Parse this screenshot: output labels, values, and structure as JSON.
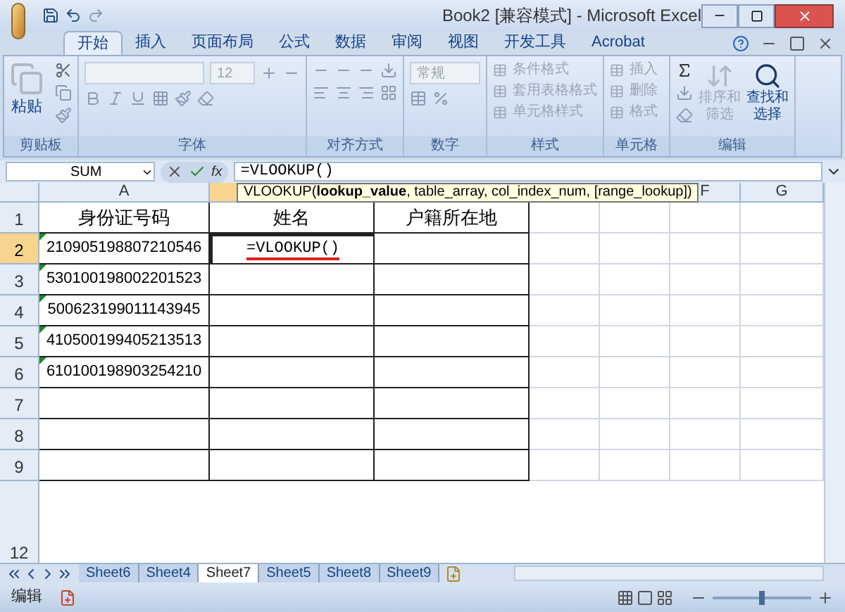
{
  "window": {
    "title": "Book2  [兼容模式] - Microsoft Excel"
  },
  "tabs": [
    {
      "label": "开始",
      "selected": true
    },
    {
      "label": "插入",
      "selected": false
    },
    {
      "label": "页面布局",
      "selected": false
    },
    {
      "label": "公式",
      "selected": false
    },
    {
      "label": "数据",
      "selected": false
    },
    {
      "label": "审阅",
      "selected": false
    },
    {
      "label": "视图",
      "selected": false
    },
    {
      "label": "开发工具",
      "selected": false
    },
    {
      "label": "Acrobat",
      "selected": false
    }
  ],
  "ribbon": [
    {
      "kind": "clipboard",
      "label": "剪贴板",
      "items": [
        {
          "label": "粘贴",
          "disabled": false
        }
      ]
    },
    {
      "kind": "font",
      "label": "字体",
      "items": [
        {
          "value": "12",
          "disabled": true
        }
      ]
    },
    {
      "kind": "align",
      "label": "对齐方式"
    },
    {
      "kind": "number",
      "label": "数字",
      "items": [
        {
          "value": "常规",
          "disabled": true
        }
      ]
    },
    {
      "kind": "styles",
      "label": "样式",
      "items": [
        {
          "label": "条件格式",
          "disabled": true
        },
        {
          "label": "套用表格格式",
          "disabled": true
        },
        {
          "label": "单元格样式",
          "disabled": true
        }
      ]
    },
    {
      "kind": "cells",
      "label": "单元格",
      "items": [
        {
          "label": "插入",
          "disabled": true
        },
        {
          "label": "删除",
          "disabled": true
        },
        {
          "label": "格式",
          "disabled": true
        }
      ]
    },
    {
      "kind": "editing",
      "label": "编辑",
      "items": [
        {
          "label": "排序和筛选",
          "disabled": true
        },
        {
          "label": "查找和选择",
          "disabled": false
        }
      ]
    }
  ],
  "formula_bar": {
    "name_box": "SUM",
    "fx": "fx",
    "formula": "=VLOOKUP()"
  },
  "tooltip": "VLOOKUP(**lookup_value**, table_array, col_index_num, [range_lookup])",
  "columns": [
    {
      "label": "A",
      "selected": false
    },
    {
      "selected": true
    },
    {
      "label": "F",
      "selected": false
    },
    {
      "label": "G",
      "selected": false
    }
  ],
  "rows": [
    {
      "label": "1",
      "selected": false,
      "cells": [
        {
          "text": "身份证号码"
        },
        {
          "text": "姓名"
        },
        {
          "text": "户籍所在地"
        }
      ]
    },
    {
      "label": "2",
      "selected": true,
      "cells": [
        {
          "text": "210905198807210546",
          "marker": true
        },
        {
          "text": "=VLOOKUP()",
          "underlined": true,
          "active": true
        },
        {}
      ]
    },
    {
      "label": "3",
      "selected": false,
      "cells": [
        {
          "text": "530100198002201523",
          "marker": true
        },
        {},
        {}
      ]
    },
    {
      "label": "4",
      "selected": false,
      "cells": [
        {
          "text": "500623199011143945",
          "marker": true
        },
        {},
        {}
      ]
    },
    {
      "label": "5",
      "selected": false,
      "cells": [
        {
          "text": "410500199405213513",
          "marker": true
        },
        {},
        {}
      ]
    },
    {
      "label": "6",
      "selected": false,
      "cells": [
        {
          "text": "610100198903254210",
          "marker": true
        },
        {},
        {}
      ]
    },
    {
      "label": "7",
      "selected": false,
      "cells": [
        {},
        {},
        {}
      ]
    },
    {
      "label": "8",
      "selected": false,
      "cells": [
        {},
        {},
        {}
      ]
    },
    {
      "label": "9",
      "selected": false,
      "cells": [
        {},
        {},
        {}
      ]
    }
  ],
  "partial_row": "12",
  "sheets": [
    {
      "label": "Sheet6",
      "selected": false
    },
    {
      "label": "Sheet4",
      "selected": false
    },
    {
      "label": "Sheet7",
      "selected": true
    },
    {
      "label": "Sheet5",
      "selected": false
    },
    {
      "label": "Sheet8",
      "selected": false
    },
    {
      "label": "Sheet9",
      "selected": false
    }
  ],
  "status_bar": {
    "mode": "编辑",
    "zoom": {
      "level": 0.5
    }
  }
}
